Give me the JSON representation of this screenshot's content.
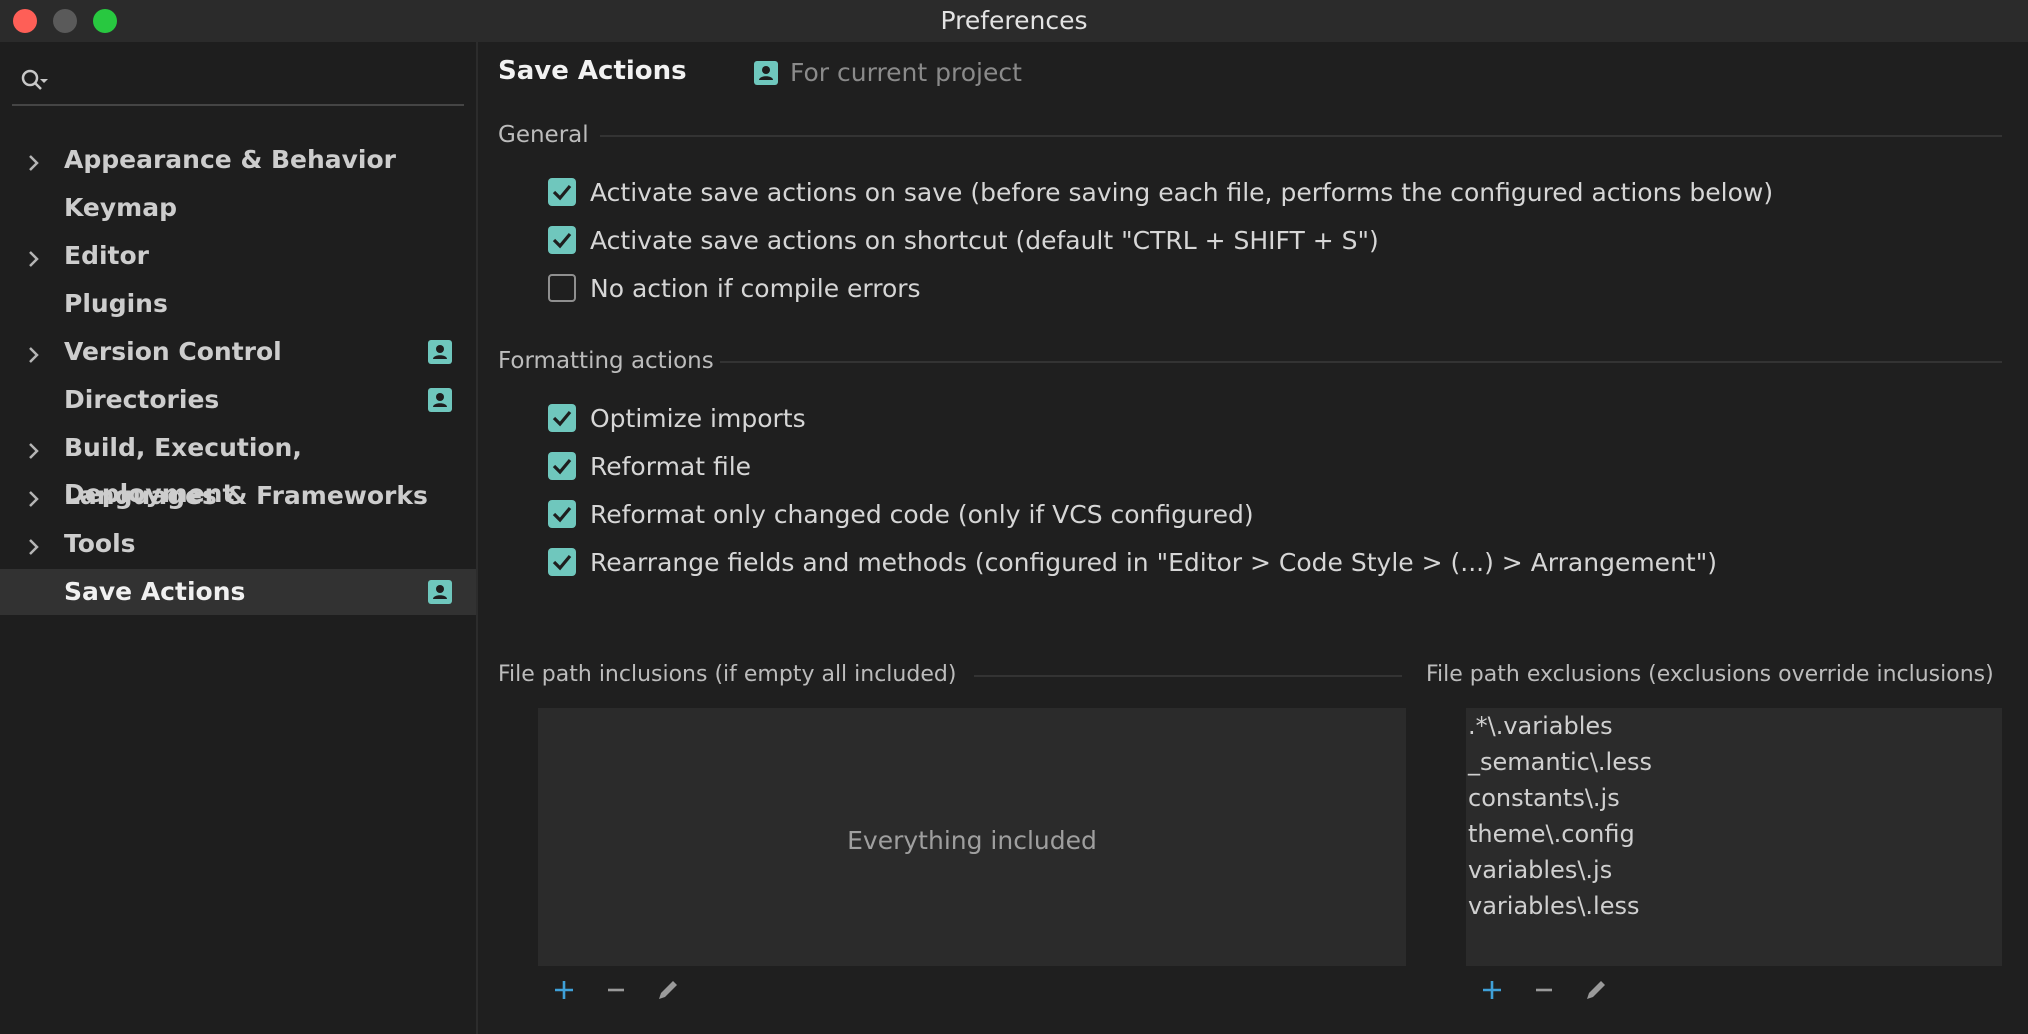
{
  "window": {
    "title": "Preferences"
  },
  "sidebar": {
    "search_placeholder": "",
    "items": [
      {
        "label": "Appearance & Behavior",
        "expandable": true,
        "project_icon": false
      },
      {
        "label": "Keymap",
        "expandable": false,
        "project_icon": false
      },
      {
        "label": "Editor",
        "expandable": true,
        "project_icon": false
      },
      {
        "label": "Plugins",
        "expandable": false,
        "project_icon": false
      },
      {
        "label": "Version Control",
        "expandable": true,
        "project_icon": true
      },
      {
        "label": "Directories",
        "expandable": false,
        "project_icon": true
      },
      {
        "label": "Build, Execution, Deployment",
        "expandable": true,
        "project_icon": false
      },
      {
        "label": "Languages & Frameworks",
        "expandable": true,
        "project_icon": false
      },
      {
        "label": "Tools",
        "expandable": true,
        "project_icon": false
      },
      {
        "label": "Save Actions",
        "expandable": false,
        "project_icon": true,
        "selected": true
      }
    ]
  },
  "main": {
    "title": "Save Actions",
    "scope_label": "For current project",
    "general": {
      "heading": "General",
      "options": [
        {
          "label": "Activate save actions on save (before saving each file, performs the configured actions below)",
          "checked": true
        },
        {
          "label": "Activate save actions on shortcut (default \"CTRL + SHIFT + S\")",
          "checked": true
        },
        {
          "label": "No action if compile errors",
          "checked": false
        }
      ]
    },
    "formatting": {
      "heading": "Formatting actions",
      "options": [
        {
          "label": "Optimize imports",
          "checked": true
        },
        {
          "label": "Reformat file",
          "checked": true
        },
        {
          "label": "Reformat only changed code (only if VCS configured)",
          "checked": true
        },
        {
          "label": "Rearrange fields and methods (configured in \"Editor > Code Style > (...) > Arrangement\")",
          "checked": true
        }
      ]
    },
    "inclusions": {
      "heading": "File path inclusions (if empty all included)",
      "empty_text": "Everything included"
    },
    "exclusions": {
      "heading": "File path exclusions (exclusions override inclusions)",
      "items": [
        ".*\\.variables",
        "_semantic\\.less",
        "constants\\.js",
        "theme\\.config",
        "variables\\.js",
        "variables\\.less"
      ]
    }
  },
  "icons": {
    "chevron": "chevron-right-icon",
    "project": "project-scope-icon",
    "add": "plus-icon",
    "remove": "minus-icon",
    "edit": "pencil-icon"
  },
  "colors": {
    "accent_teal": "#6fc7bd",
    "add_blue": "#3fa0d8",
    "background": "#1f1f1f"
  }
}
